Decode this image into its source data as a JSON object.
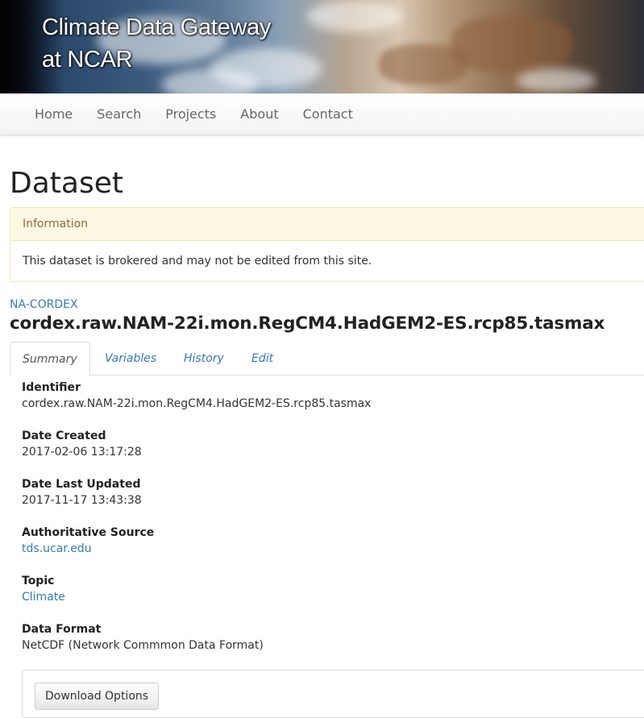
{
  "banner": {
    "title_line1": "Climate Data Gateway",
    "title_line2": "at NCAR"
  },
  "nav": {
    "items": [
      "Home",
      "Search",
      "Projects",
      "About",
      "Contact"
    ]
  },
  "page": {
    "title": "Dataset"
  },
  "info_panel": {
    "heading": "Information",
    "message": "This dataset is brokered and may not be edited from this site."
  },
  "dataset": {
    "project": "NA-CORDEX",
    "title": "cordex.raw.NAM-22i.mon.RegCM4.HadGEM2-ES.rcp85.tasmax"
  },
  "tabs": {
    "items": [
      "Summary",
      "Variables",
      "History",
      "Edit"
    ],
    "active": "Summary"
  },
  "summary": {
    "fields": [
      {
        "label": "Identifier",
        "value": "cordex.raw.NAM-22i.mon.RegCM4.HadGEM2-ES.rcp85.tasmax"
      },
      {
        "label": "Date Created",
        "value": "2017-02-06 13:17:28"
      },
      {
        "label": "Date Last Updated",
        "value": "2017-11-17 13:43:38"
      },
      {
        "label": "Authoritative Source",
        "value": "tds.ucar.edu"
      },
      {
        "label": "Topic",
        "value": "Climate"
      },
      {
        "label": "Data Format",
        "value": "NetCDF (Network Commmon Data Format)"
      }
    ]
  },
  "download": {
    "button_label": "Download Options"
  },
  "colors": {
    "link": "#337ab7",
    "info_heading_bg": "#fcf8e3",
    "info_heading_text": "#8a6d3b"
  }
}
